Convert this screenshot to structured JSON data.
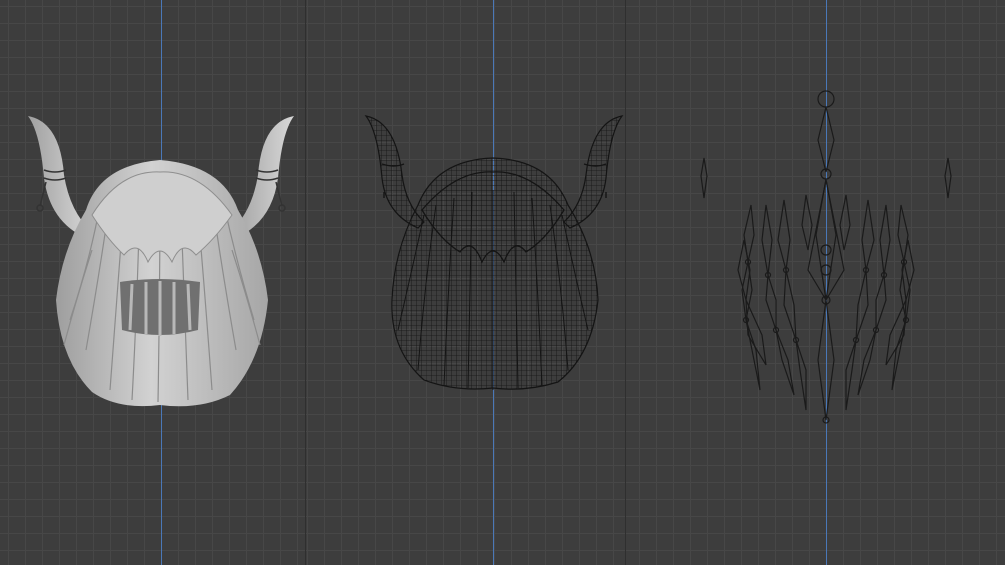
{
  "app": {
    "title": ""
  },
  "viewports": [
    {
      "mode": "solid",
      "object": "horned-hair-mesh"
    },
    {
      "mode": "wireframe",
      "object": "horned-hair-mesh"
    },
    {
      "mode": "armature",
      "object": "hair-armature"
    }
  ],
  "colors": {
    "background": "#3d3d3d",
    "grid": "#474747",
    "z_axis": "#4a78b8",
    "solid_mesh": "#bdbdbd",
    "wireframe": "#151515",
    "bones": "#1a1a1a"
  }
}
